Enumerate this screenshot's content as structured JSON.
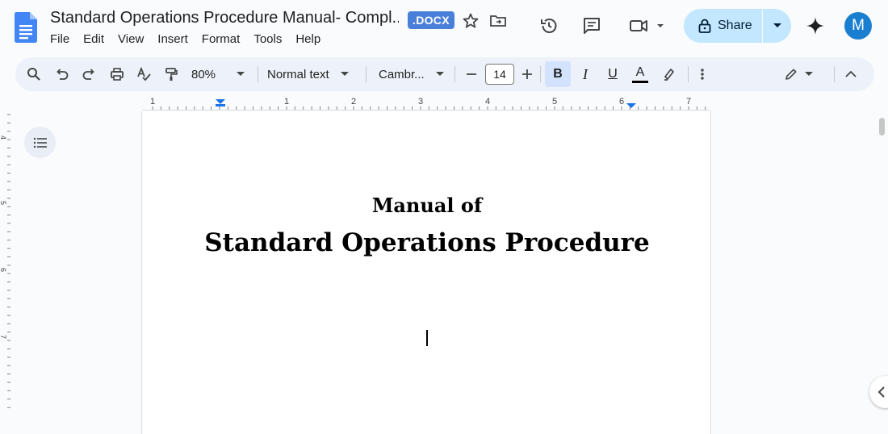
{
  "document": {
    "title": "Standard Operations Procedure Manual- Compl...",
    "format_badge": ".DOCX"
  },
  "menu": [
    "File",
    "Edit",
    "View",
    "Insert",
    "Format",
    "Tools",
    "Help"
  ],
  "share": {
    "label": "Share"
  },
  "avatar": {
    "initial": "M",
    "color": "#1a7fd1"
  },
  "toolbar": {
    "zoom": "80%",
    "style": "Normal text",
    "font": "Cambr...",
    "font_size": "14",
    "bold_label": "B",
    "italic_label": "I",
    "underline_label": "U",
    "text_color_label": "A"
  },
  "ruler": {
    "labels": [
      "1",
      "1",
      "2",
      "3",
      "4",
      "5",
      "6",
      "7"
    ],
    "vertical_labels": [
      "4",
      "5",
      "6",
      "7"
    ]
  },
  "page": {
    "heading_small": "Manual of",
    "heading_large": "Standard Operations Procedure"
  },
  "colors": {
    "accent": "#0b57d0",
    "share_bg": "#c2e7ff",
    "toolbar_bg": "#edf2fa",
    "badge_bg": "#4a7fd9"
  }
}
